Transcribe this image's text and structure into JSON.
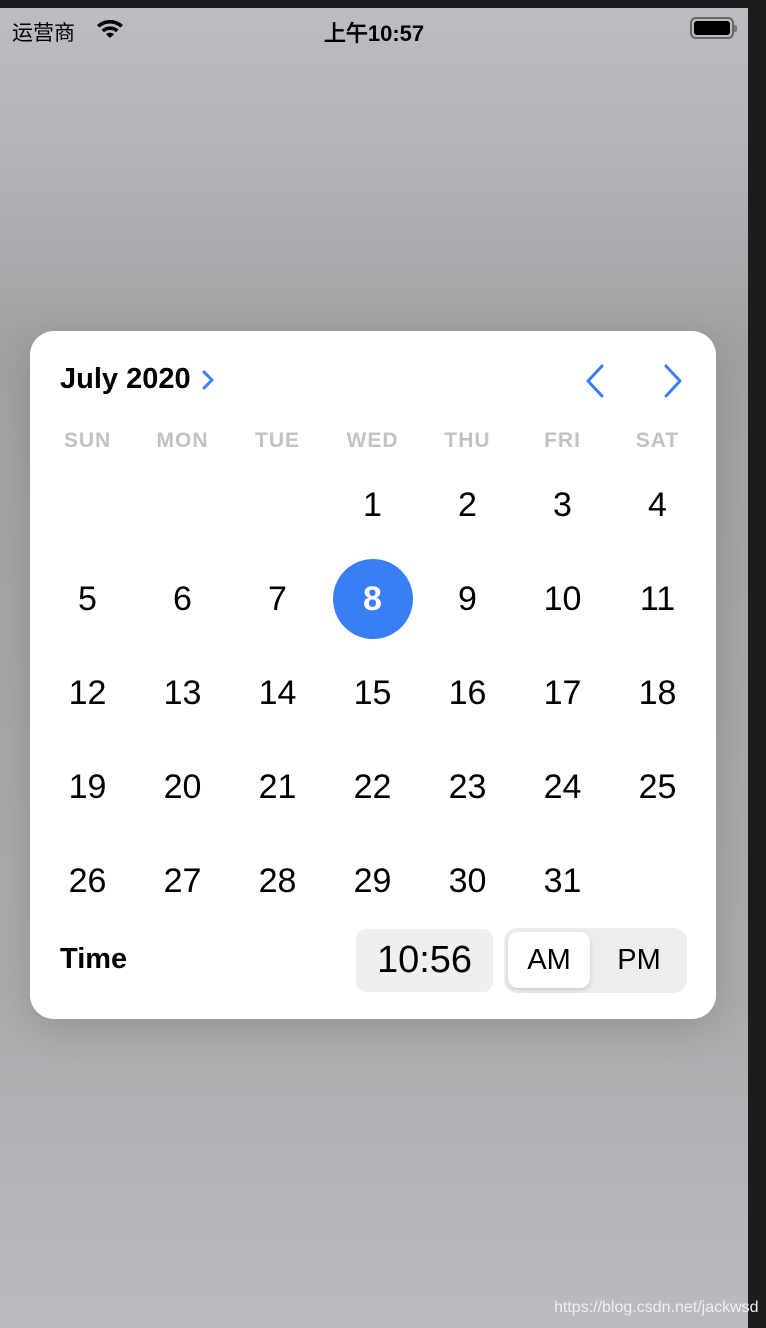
{
  "status_bar": {
    "carrier": "运营商",
    "time": "上午10:57",
    "icons": [
      "wifi-icon",
      "battery-icon"
    ]
  },
  "picker": {
    "month_label": "July 2020",
    "weekdays": [
      "SUN",
      "MON",
      "TUE",
      "WED",
      "THU",
      "FRI",
      "SAT"
    ],
    "first_weekday_index": 3,
    "days": [
      "1",
      "2",
      "3",
      "4",
      "5",
      "6",
      "7",
      "8",
      "9",
      "10",
      "11",
      "12",
      "13",
      "14",
      "15",
      "16",
      "17",
      "18",
      "19",
      "20",
      "21",
      "22",
      "23",
      "24",
      "25",
      "26",
      "27",
      "28",
      "29",
      "30",
      "31"
    ],
    "selected_day": "8",
    "time_label": "Time",
    "time_value": "10:56",
    "am_label": "AM",
    "pm_label": "PM",
    "selected_period": "AM",
    "accent_color": "#3a7ef5"
  },
  "watermark": "https://blog.csdn.net/jackwsd"
}
